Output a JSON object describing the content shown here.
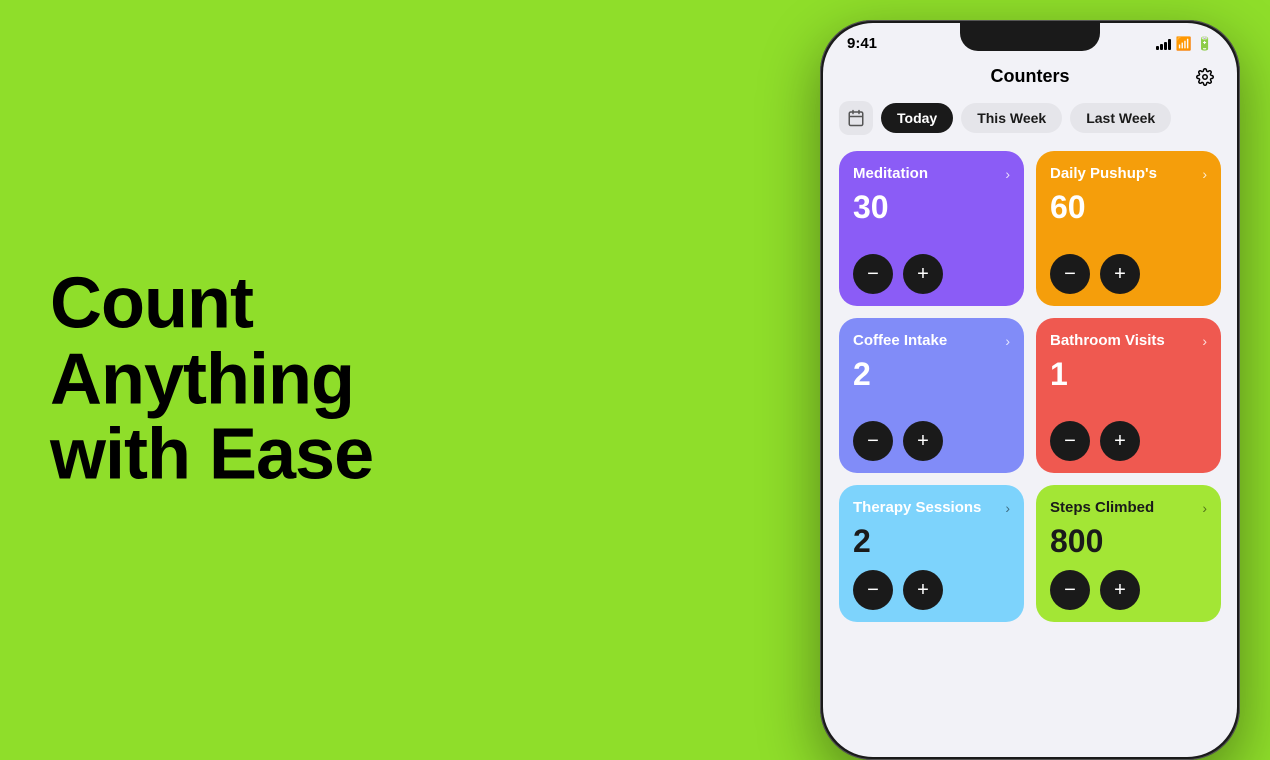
{
  "background": {
    "color": "#8fde2a"
  },
  "headline": {
    "line1": "Count",
    "line2": "Anything",
    "line3": "with Ease"
  },
  "phone": {
    "status_bar": {
      "time": "9:41",
      "signal": "signal",
      "wifi": "wifi",
      "battery": "battery"
    },
    "app": {
      "title": "Counters",
      "settings_icon": "gear",
      "filters": [
        {
          "label": "Today",
          "active": true
        },
        {
          "label": "This Week",
          "active": false
        },
        {
          "label": "Last Week",
          "active": false
        }
      ],
      "counters": [
        {
          "name": "Meditation",
          "count": "30",
          "color": "purple",
          "id": "meditation"
        },
        {
          "name": "Daily Pushup's",
          "count": "60",
          "color": "yellow",
          "id": "pushups"
        },
        {
          "name": "Coffee Intake",
          "count": "2",
          "color": "blue-mid",
          "id": "coffee"
        },
        {
          "name": "Bathroom Visits",
          "count": "1",
          "color": "red",
          "id": "bathroom"
        },
        {
          "name": "Therapy Sessions",
          "count": "2",
          "color": "blue-light",
          "id": "therapy"
        },
        {
          "name": "Steps Climbed",
          "count": "800",
          "color": "green-light",
          "id": "steps"
        }
      ],
      "decrement_label": "−",
      "increment_label": "+"
    }
  }
}
